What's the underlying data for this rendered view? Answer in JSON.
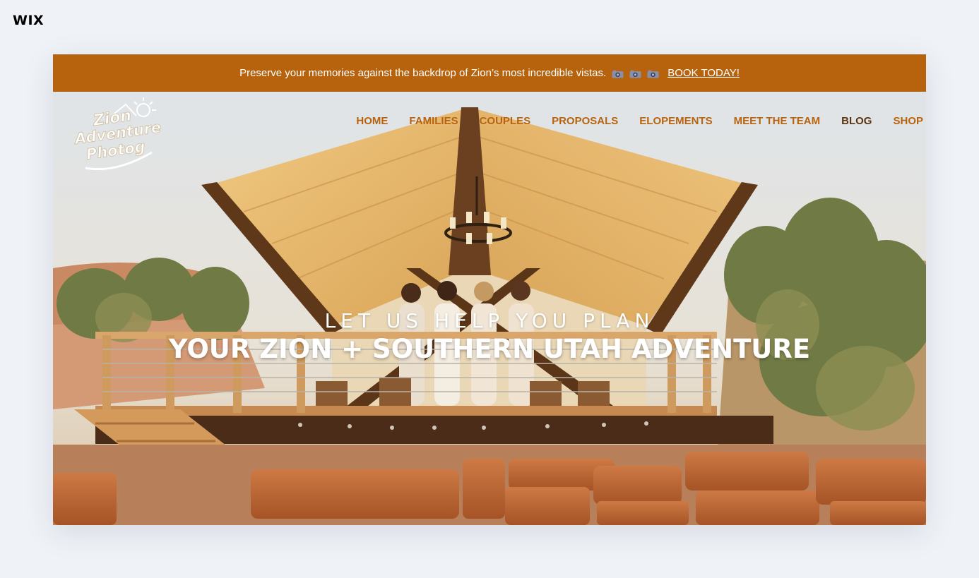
{
  "wix": {
    "logo_text": "WIX"
  },
  "promo": {
    "text": "Preserve your memories against the backdrop of Zion’s most incredible vistas.",
    "icons": [
      "camera-icon",
      "camera-icon",
      "camera-icon"
    ],
    "link_label": "BOOK TODAY!"
  },
  "logo": {
    "line1": "Zion",
    "line2": "Adventure",
    "line3": "Photog"
  },
  "nav": {
    "items": [
      {
        "label": "HOME"
      },
      {
        "label": "FAMILIES"
      },
      {
        "label": "COUPLES"
      },
      {
        "label": "PROPOSALS"
      },
      {
        "label": "ELOPEMENTS"
      },
      {
        "label": "MEET THE TEAM"
      },
      {
        "label": "BLOG"
      },
      {
        "label": "SHOP"
      }
    ]
  },
  "hero": {
    "subtitle": "LET US HELP YOU PLAN",
    "title": "YOUR ZION + SOUTHERN UTAH ADVENTURE"
  },
  "colors": {
    "accent": "#b7630e",
    "nav_active": "#5a3411",
    "page_bg": "#eff3f8"
  }
}
